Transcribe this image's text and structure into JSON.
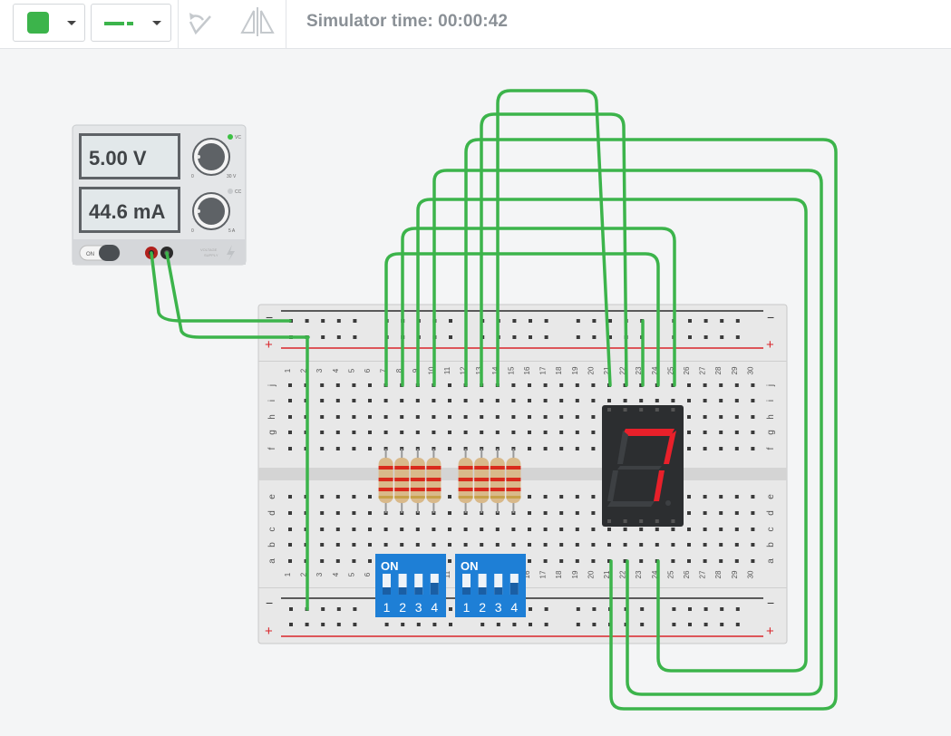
{
  "toolbar": {
    "color_label": "wire color",
    "color_value": "#3cb44b",
    "wire_type_label": "wire type",
    "rotate_icon": "rotate-icon",
    "flip_icon": "flip-icon",
    "sim_time": "Simulator time: 00:00:42"
  },
  "power_supply": {
    "voltage": "5.00 V",
    "current": "44.6 mA",
    "vc_label": "VC",
    "cc_label": "CC",
    "knob1_min": "0",
    "knob1_max": "30 V",
    "knob2_min": "0",
    "knob2_max": "5 A",
    "on_label": "ON",
    "brand_line1": "VOLTAGE",
    "brand_line2": "SUPPLY"
  },
  "breadboard": {
    "columns": [
      "1",
      "2",
      "3",
      "4",
      "5",
      "6",
      "7",
      "8",
      "9",
      "10",
      "11",
      "12",
      "13",
      "14",
      "15",
      "16",
      "17",
      "18",
      "19",
      "20",
      "21",
      "22",
      "23",
      "24",
      "25",
      "26",
      "27",
      "28",
      "29",
      "30"
    ],
    "rows_top": [
      "j",
      "i",
      "h",
      "g",
      "f"
    ],
    "rows_bottom": [
      "e",
      "d",
      "c",
      "b",
      "a"
    ],
    "rail_minus": "−",
    "rail_plus": "+"
  },
  "dip_switches": [
    {
      "on_label": "ON",
      "numbers": [
        "1",
        "2",
        "3",
        "4"
      ]
    },
    {
      "on_label": "ON",
      "numbers": [
        "1",
        "2",
        "3",
        "4"
      ]
    }
  ],
  "display": {
    "digit": "7",
    "segment_color": "#e8202a"
  },
  "colors": {
    "wire": "#3cb44b",
    "rail_red": "#d9262b",
    "rail_black": "#2b2b2b",
    "dip_blue": "#1e7fd6"
  }
}
